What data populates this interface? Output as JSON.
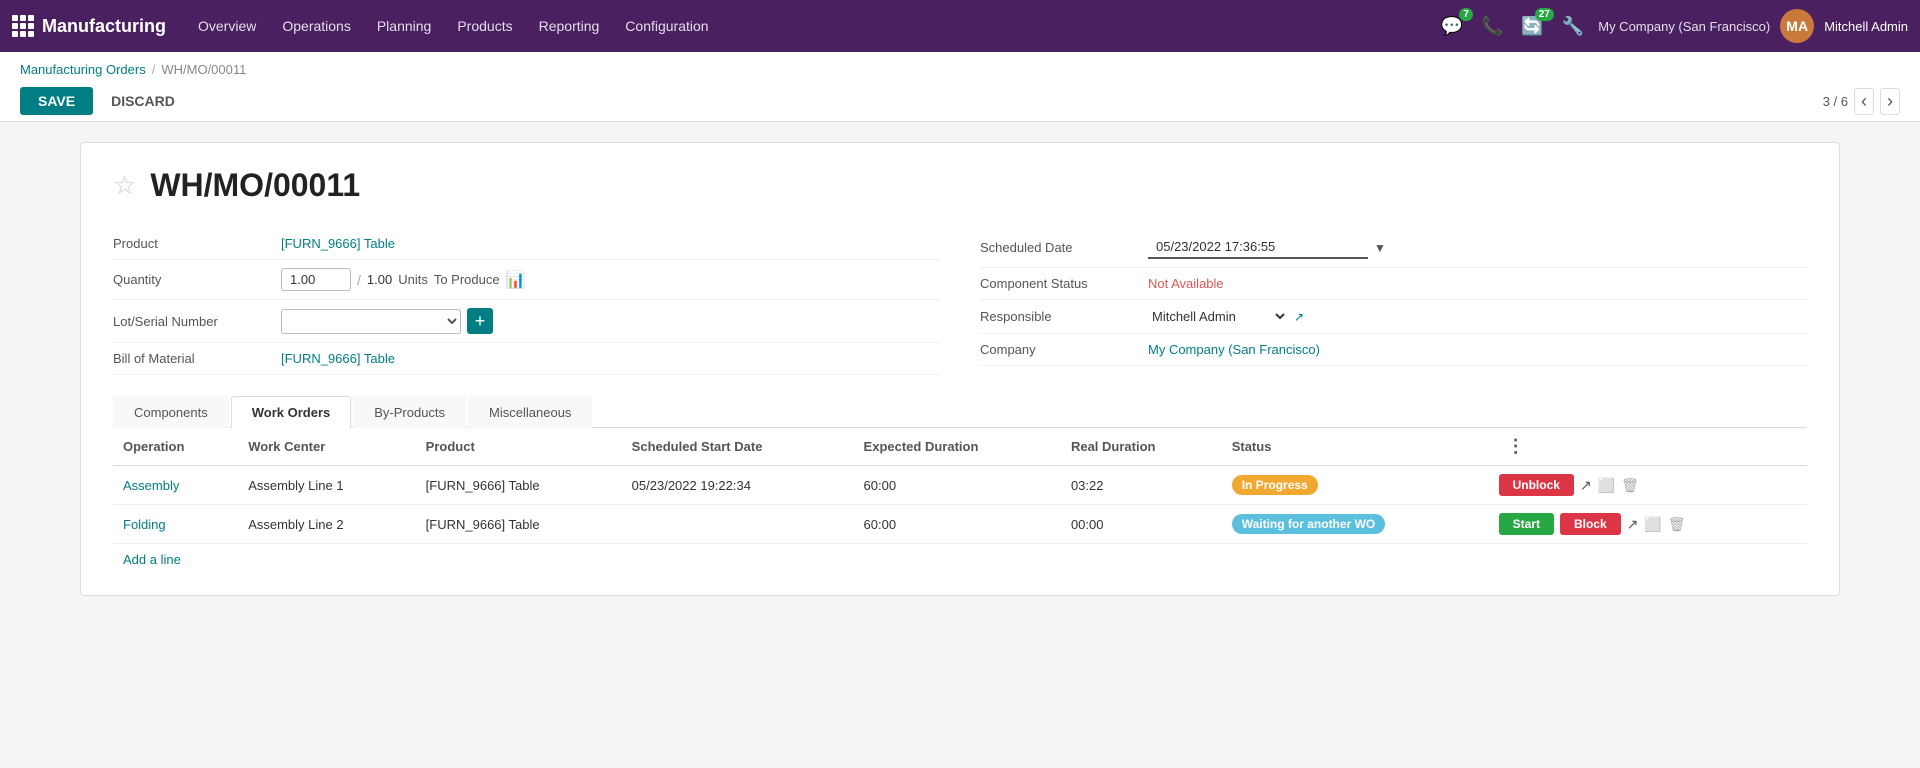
{
  "app": {
    "name": "Manufacturing"
  },
  "nav": {
    "menu": [
      {
        "label": "Overview",
        "id": "overview"
      },
      {
        "label": "Operations",
        "id": "operations"
      },
      {
        "label": "Planning",
        "id": "planning"
      },
      {
        "label": "Products",
        "id": "products"
      },
      {
        "label": "Reporting",
        "id": "reporting"
      },
      {
        "label": "Configuration",
        "id": "configuration"
      }
    ],
    "chat_badge": "7",
    "activity_badge": "27",
    "company": "My Company (San Francisco)",
    "username": "Mitchell Admin"
  },
  "breadcrumb": {
    "parent": "Manufacturing Orders",
    "current": "WH/MO/00011"
  },
  "toolbar": {
    "save_label": "SAVE",
    "discard_label": "DISCARD",
    "pagination": "3 / 6"
  },
  "form": {
    "title": "WH/MO/00011",
    "product_label": "Product",
    "product_value": "[FURN_9666] Table",
    "quantity_label": "Quantity",
    "quantity_current": "1.00",
    "quantity_total": "1.00",
    "quantity_unit": "Units",
    "quantity_to_produce": "To Produce",
    "lot_label": "Lot/Serial Number",
    "bom_label": "Bill of Material",
    "bom_value": "[FURN_9666] Table",
    "scheduled_date_label": "Scheduled Date",
    "scheduled_date_value": "05/23/2022 17:36:55",
    "component_status_label": "Component Status",
    "component_status_value": "Not Available",
    "responsible_label": "Responsible",
    "responsible_value": "Mitchell Admin",
    "company_label": "Company",
    "company_value": "My Company (San Francisco)"
  },
  "tabs": [
    {
      "label": "Components",
      "id": "components"
    },
    {
      "label": "Work Orders",
      "id": "work-orders",
      "active": true
    },
    {
      "label": "By-Products",
      "id": "by-products"
    },
    {
      "label": "Miscellaneous",
      "id": "miscellaneous"
    }
  ],
  "table": {
    "columns": [
      {
        "label": "Operation"
      },
      {
        "label": "Work Center"
      },
      {
        "label": "Product"
      },
      {
        "label": "Scheduled Start Date"
      },
      {
        "label": "Expected Duration"
      },
      {
        "label": "Real Duration"
      },
      {
        "label": "Status"
      }
    ],
    "rows": [
      {
        "operation": "Assembly",
        "work_center": "Assembly Line 1",
        "product": "[FURN_9666] Table",
        "scheduled_start": "05/23/2022 19:22:34",
        "expected_duration": "60:00",
        "real_duration": "03:22",
        "status": "In Progress",
        "status_class": "badge-inprogress",
        "action1": "Unblock",
        "action1_class": "btn-unblock"
      },
      {
        "operation": "Folding",
        "work_center": "Assembly Line 2",
        "product": "[FURN_9666] Table",
        "scheduled_start": "",
        "expected_duration": "60:00",
        "real_duration": "00:00",
        "status": "Waiting for another WO",
        "status_class": "badge-waiting",
        "action1": "Start",
        "action1_class": "btn-start",
        "action2": "Block",
        "action2_class": "btn-block"
      }
    ],
    "add_line": "Add a line"
  }
}
